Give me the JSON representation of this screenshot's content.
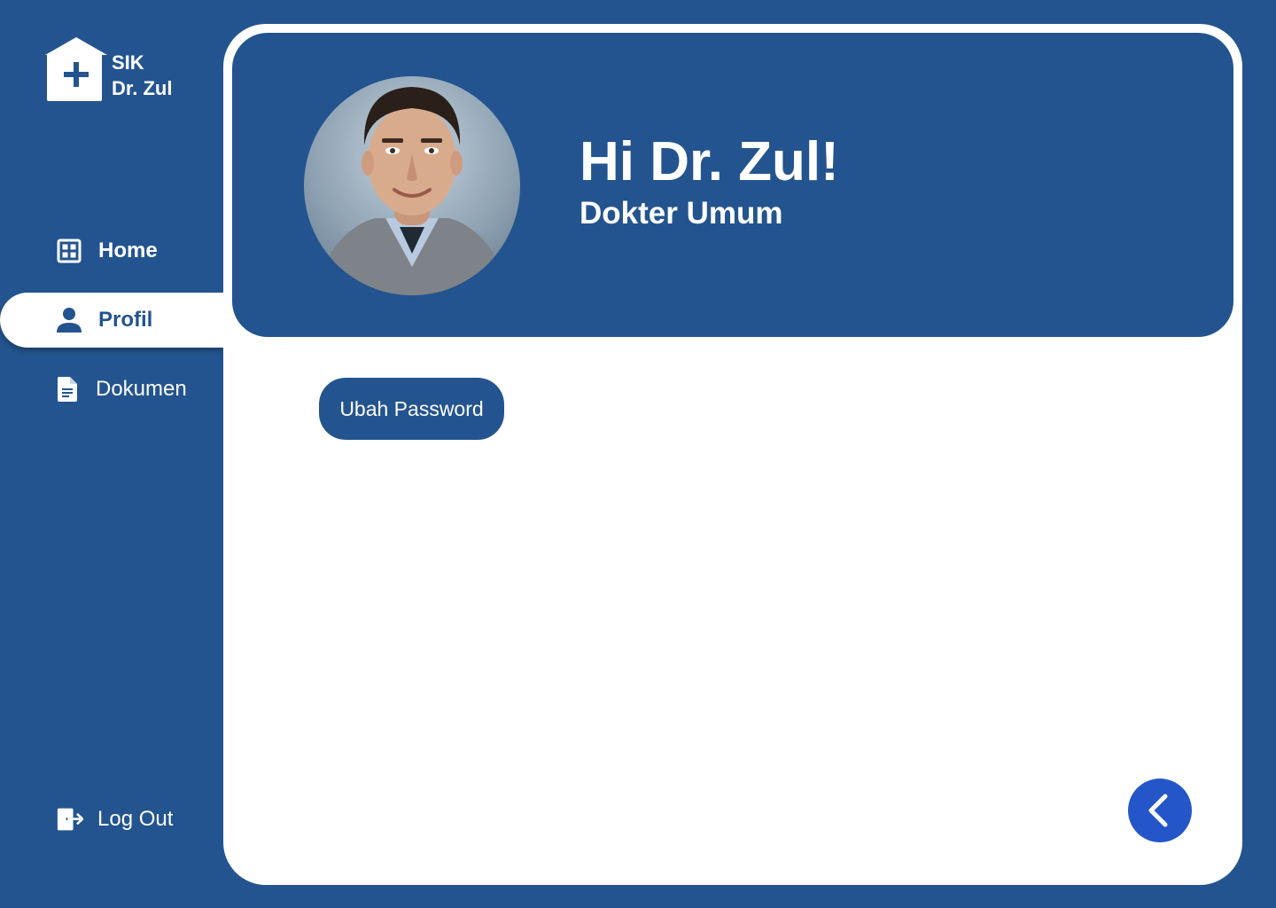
{
  "brand": {
    "line1": "SIK",
    "line2": "Dr. Zul"
  },
  "sidebar": {
    "items": [
      {
        "label": "Home",
        "icon": "grid-icon",
        "active": false
      },
      {
        "label": "Profil",
        "icon": "user-icon",
        "active": true
      },
      {
        "label": "Dokumen",
        "icon": "document-icon",
        "active": false
      }
    ],
    "logout_label": "Log Out"
  },
  "profile": {
    "greeting": "Hi Dr. Zul!",
    "role": "Dokter Umum",
    "avatar_alt": "profile-photo"
  },
  "actions": {
    "change_password_label": "Ubah Password"
  },
  "colors": {
    "primary": "#23548f",
    "accent": "#2456c9",
    "surface": "#ffffff"
  }
}
